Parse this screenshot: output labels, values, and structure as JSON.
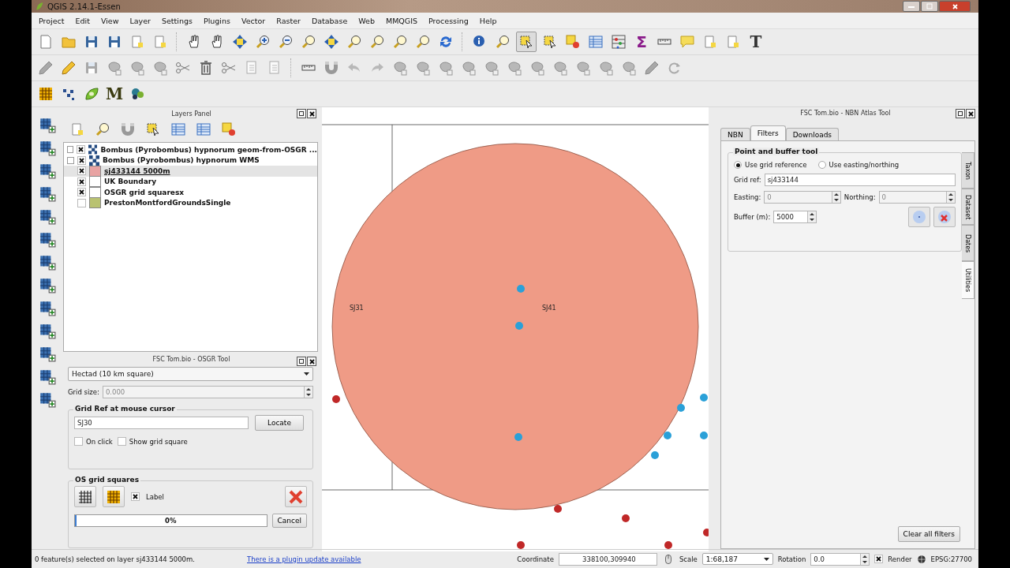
{
  "window": {
    "title": "QGIS 2.14.1-Essen"
  },
  "menu": [
    "Project",
    "Edit",
    "View",
    "Layer",
    "Settings",
    "Plugins",
    "Vector",
    "Raster",
    "Database",
    "Web",
    "MMQGIS",
    "Processing",
    "Help"
  ],
  "attributes_toolbar": {
    "statistics_button": "Σ",
    "text_annotation_button": "T"
  },
  "plugins_toolbar": {
    "mmqgis_button": "M"
  },
  "layers_panel": {
    "title": "Layers Panel",
    "layers": [
      {
        "name": "Bombus (Pyrobombus) hypnorum geom-from-OSGR ...",
        "kind": "raster",
        "checked": true,
        "selected": false
      },
      {
        "name": "Bombus (Pyrobombus) hypnorum WMS",
        "kind": "raster",
        "checked": true,
        "selected": false
      },
      {
        "name": "sj433144 5000m",
        "kind": "vector",
        "color": "#e8a3a3",
        "checked": true,
        "selected": true
      },
      {
        "name": "UK Boundary",
        "kind": "vector",
        "color": "#ffffff",
        "checked": true,
        "selected": false
      },
      {
        "name": "OSGR grid squaresx",
        "kind": "vector",
        "color": "#ffffff",
        "checked": true,
        "selected": false
      },
      {
        "name": "PrestonMontfordGroundsSingle",
        "kind": "vector",
        "color": "#b9c271",
        "checked": false,
        "selected": false
      }
    ]
  },
  "osgr_tool": {
    "title": "FSC Tom.bio - OSGR Tool",
    "precision": "Hectad (10 km square)",
    "grid_size_label": "Grid size:",
    "grid_size": "0.000",
    "grid_ref_group": {
      "title": "Grid Ref at mouse cursor",
      "grid_ref": "SJ30",
      "locate_button": "Locate",
      "options": [
        {
          "label": "On click",
          "checked": false
        },
        {
          "label": "Show grid square",
          "checked": false
        }
      ]
    },
    "os_group": {
      "title": "OS grid squares",
      "label_option": {
        "label": "Label",
        "checked": true
      },
      "progress": {
        "level": 0.01,
        "text": "0%"
      },
      "cancel_button": "Cancel"
    }
  },
  "map": {
    "labels": [
      "SJ31",
      "SJ41"
    ]
  },
  "nbn_tool": {
    "title": "FSC Tom.bio - NBN Atlas Tool",
    "tabs": [
      {
        "label": "NBN",
        "selected": false
      },
      {
        "label": "Filters",
        "selected": true
      },
      {
        "label": "Downloads",
        "selected": false
      }
    ],
    "side_tabs": [
      {
        "label": "Taxon",
        "selected": false
      },
      {
        "label": "Dataset",
        "selected": false
      },
      {
        "label": "Dates",
        "selected": false
      },
      {
        "label": "Utilities",
        "selected": true
      }
    ],
    "point_buffer": {
      "title": "Point and buffer tool",
      "modes": [
        {
          "label": "Use grid reference",
          "selected": true
        },
        {
          "label": "Use easting/northing",
          "selected": false
        }
      ],
      "grid_ref_label": "Grid ref:",
      "grid_ref": "sj433144",
      "easting_label": "Easting:",
      "easting": "0",
      "northing_label": "Northing:",
      "northing": "0",
      "buffer_label": "Buffer (m):",
      "buffer": "5000"
    },
    "clear_button": "Clear all filters"
  },
  "status_bar": {
    "message": "0 feature(s) selected on layer sj433144 5000m.",
    "link": "There is a plugin update available",
    "coordinate_label": "Coordinate",
    "coordinate": "338100,309940",
    "scale_label": "Scale",
    "scale": "1:68,187",
    "rotation_label": "Rotation",
    "rotation": "0.0",
    "render": {
      "label": "Render",
      "checked": true
    },
    "crs": "EPSG:27700"
  }
}
